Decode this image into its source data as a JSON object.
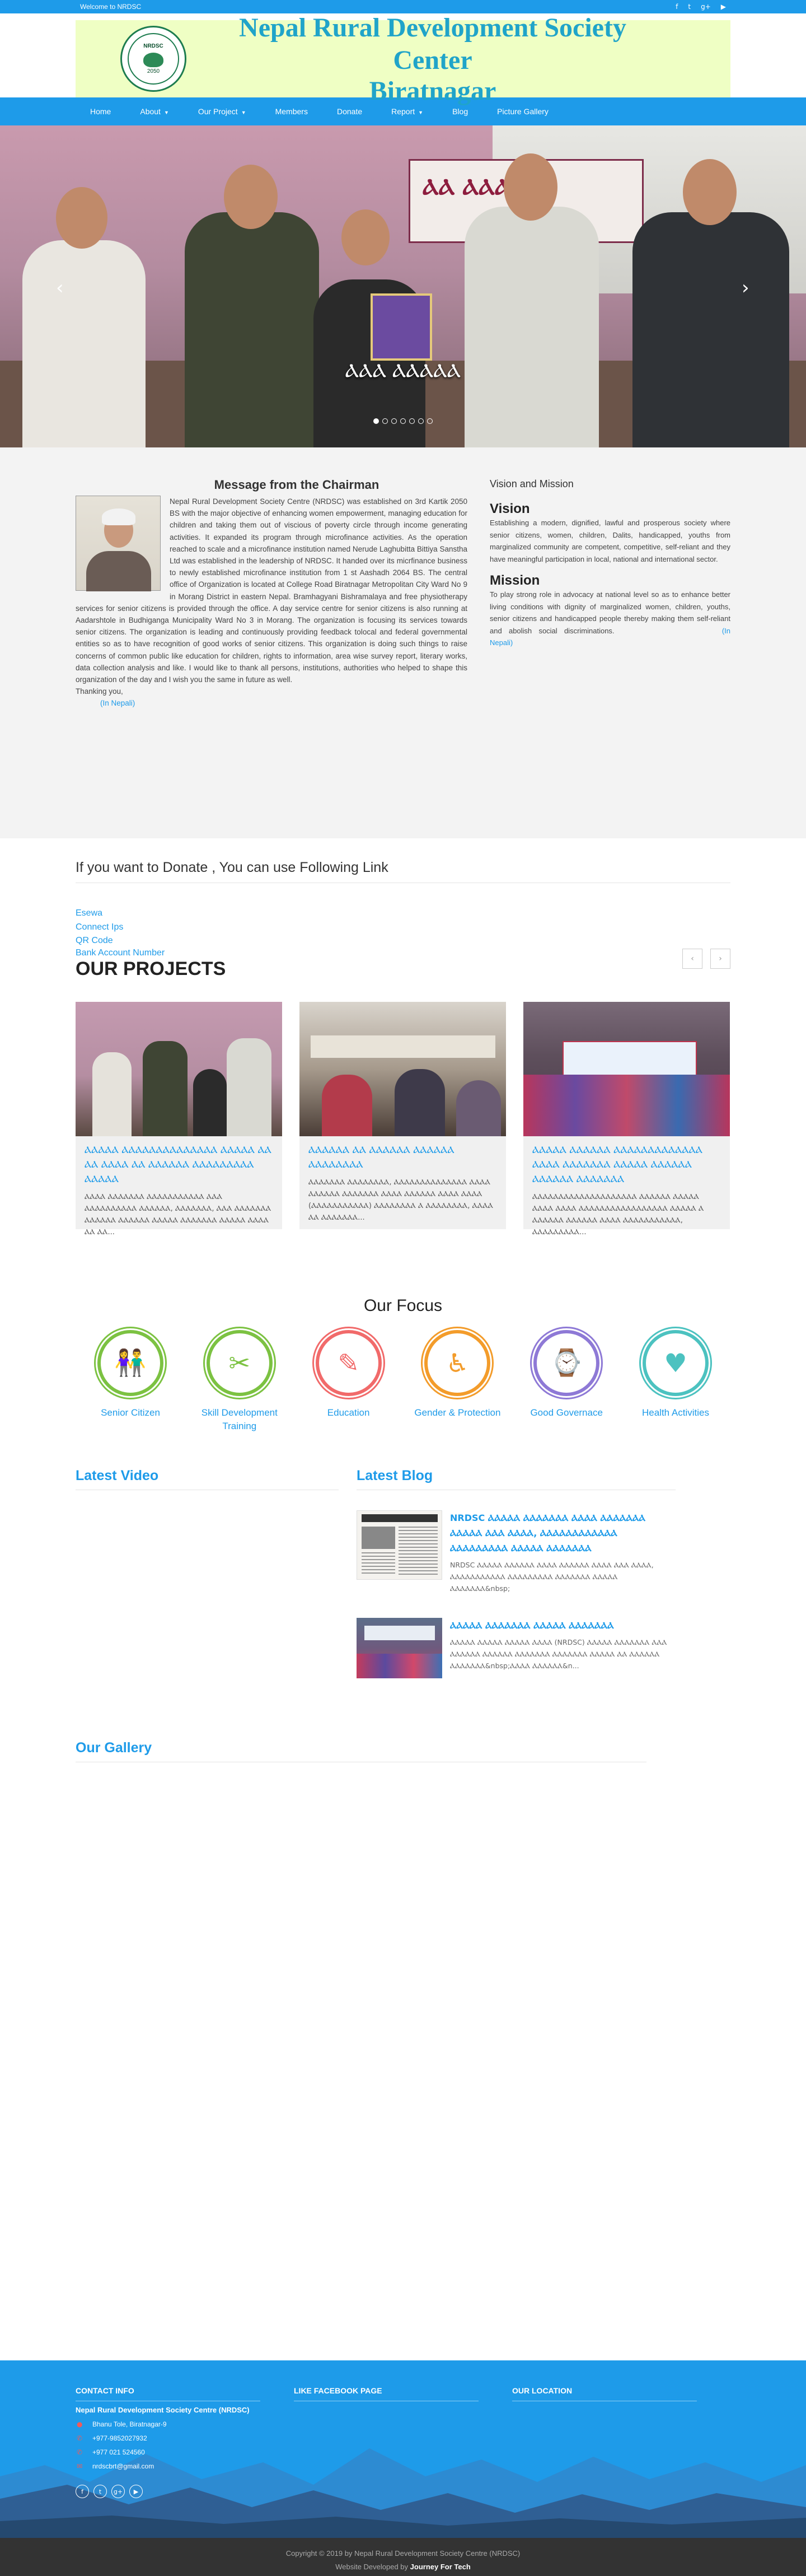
{
  "topbar": {
    "welcome": "Welcome to NRDSC",
    "social": [
      "f",
      "t",
      "g+",
      "▶"
    ]
  },
  "banner": {
    "line1": "Nepal Rural Development Society Center",
    "line2": "Biratnagar",
    "logo_text": "NRDSC",
    "logo_year": "2050"
  },
  "nav": [
    {
      "label": "Home",
      "caret": false
    },
    {
      "label": "About",
      "caret": true
    },
    {
      "label": "Our Project",
      "caret": true
    },
    {
      "label": "Members",
      "caret": false
    },
    {
      "label": "Donate",
      "caret": false
    },
    {
      "label": "Report",
      "caret": true
    },
    {
      "label": "Blog",
      "caret": false
    },
    {
      "label": "Picture Gallery",
      "caret": false
    }
  ],
  "slider": {
    "caption": "ⲀⲀⲀ ⲀⲀⲀⲀⲀ",
    "prev": "‹",
    "next": "›",
    "dots": 7,
    "active": 0,
    "banner_text": "ⲀⲀ ⲀⲀⲀⲀ"
  },
  "chairman": {
    "title": "Message from the Chairman",
    "body": "Nepal Rural Development Society Centre (NRDSC) was established on 3rd Kartik 2050 BS with the major objective of enhancing women empowerment, managing education for children and taking them out of viscious of poverty circle through income generating activities. It expanded its program through microfinance activities. As the operation reached to scale and a microfinance institution named Nerude Laghubitta Bittiya Sanstha Ltd was established in the leadership of NRDSC. It handed over its micrfinance business to newly established microfinance institution from 1 st Aashadh 2064 BS. The central office of Organization is located at College Road Biratnagar Metropolitan City Ward No 9 in Morang District in eastern Nepal. Bramhagyani Bishramalaya and free physiotherapy services for senior citizens is provided through the office. A day service centre for senior citizens is also running at Aadarshtole in Budhiganga Municipality Ward No 3 in Morang. The organization is focusing its services towards senior citizens. The organization is leading and continuously providing feedback tolocal and federal governmental entities so as to have recognition of good works of senior citizens. This organization is doing such things to raise concerns of common public like education for children, rights to information, area wise survey report, literary works, data collection analysis and like. I would like to thank all persons, institutions, authorities who helped to shape this organization of the day and I wish you the same in future as well.",
    "thanks": "Thanking you,",
    "nepali_link": "(In Nepali)"
  },
  "vision": {
    "heading": "Vision and Mission",
    "vision_title": "Vision",
    "vision_text": "Establishing a modern, dignified, lawful and prosperous society where senior citizens, women, children, Dalits, handicapped, youths from marginalized community are competent, competitive, self-reliant and they have meaningful participation in local, national and international sector.",
    "mission_title": "Mission",
    "mission_text": "To play strong role in advocacy at national level so as to enhance better living conditions with dignity of marginalized women, children, youths, senior citizens and handicapped people thereby making them self-reliant and abolish social discriminations.",
    "nepali_link": "(In Nepali)"
  },
  "donate": {
    "title": "If you want to Donate , You can use Following Link",
    "links": [
      "Esewa",
      "Connect Ips",
      "QR Code",
      "Bank Account Number"
    ]
  },
  "projects": {
    "title": "OUR PROJECTS",
    "prev": "‹",
    "next": "›",
    "items": [
      {
        "title": "ⲀⲀⲀⲀⲀ ⲀⲀⲀⲀⲀⲀⲀⲀⲀⲀⲀⲀⲀⲀ ⲀⲀⲀⲀⲀ ⲀⲀ ⲀⲀ ⲀⲀⲀⲀ ⲀⲀ ⲀⲀⲀⲀⲀⲀ ⲀⲀⲀⲀⲀⲀⲀⲀⲀ ⲀⲀⲀⲀⲀ",
        "desc": "ⲀⲀⲀⲀ ⲀⲀⲀⲀⲀⲀⲀ ⲀⲀⲀⲀⲀⲀⲀⲀⲀⲀⲀ ⲀⲀⲀ ⲀⲀⲀⲀⲀⲀⲀⲀⲀⲀ ⲀⲀⲀⲀⲀⲀ, ⲀⲀⲀⲀⲀⲀⲀ, ⲀⲀⲀ ⲀⲀⲀⲀⲀⲀⲀ ⲀⲀⲀⲀⲀⲀ ⲀⲀⲀⲀⲀⲀ ⲀⲀⲀⲀⲀ ⲀⲀⲀⲀⲀⲀⲀ ⲀⲀⲀⲀⲀ ⲀⲀⲀⲀ ⲀⲀ ⲀⲀ..."
      },
      {
        "title": "ⲀⲀⲀⲀⲀⲀ ⲀⲀ ⲀⲀⲀⲀⲀⲀ ⲀⲀⲀⲀⲀⲀ ⲀⲀⲀⲀⲀⲀⲀⲀ",
        "desc": "ⲀⲀⲀⲀⲀⲀⲀ ⲀⲀⲀⲀⲀⲀⲀⲀ, ⲀⲀⲀⲀⲀⲀⲀⲀⲀⲀⲀⲀⲀⲀ ⲀⲀⲀⲀ ⲀⲀⲀⲀⲀⲀ ⲀⲀⲀⲀⲀⲀⲀ ⲀⲀⲀⲀ ⲀⲀⲀⲀⲀⲀ ⲀⲀⲀⲀ ⲀⲀⲀⲀ (ⲀⲀⲀⲀⲀⲀⲀⲀⲀⲀⲀ) ⲀⲀⲀⲀⲀⲀⲀⲀ Ⲁ ⲀⲀⲀⲀⲀⲀⲀⲀ, ⲀⲀⲀⲀ ⲀⲀ ⲀⲀⲀⲀⲀⲀⲀ..."
      },
      {
        "title": "ⲀⲀⲀⲀⲀ ⲀⲀⲀⲀⲀⲀ ⲀⲀⲀⲀⲀⲀⲀⲀⲀⲀⲀⲀⲀ ⲀⲀⲀⲀ ⲀⲀⲀⲀⲀⲀⲀ ⲀⲀⲀⲀⲀ ⲀⲀⲀⲀⲀⲀ ⲀⲀⲀⲀⲀⲀ ⲀⲀⲀⲀⲀⲀⲀ",
        "desc": "ⲀⲀⲀⲀⲀⲀⲀⲀⲀⲀⲀⲀⲀⲀⲀⲀⲀⲀⲀⲀ ⲀⲀⲀⲀⲀⲀ ⲀⲀⲀⲀⲀ ⲀⲀⲀⲀ ⲀⲀⲀⲀ ⲀⲀⲀⲀⲀⲀⲀⲀⲀⲀⲀⲀⲀⲀⲀⲀⲀ ⲀⲀⲀⲀⲀ Ⲁ ⲀⲀⲀⲀⲀⲀ ⲀⲀⲀⲀⲀⲀ ⲀⲀⲀⲀ ⲀⲀⲀⲀⲀⲀⲀⲀⲀⲀⲀ, ⲀⲀⲀⲀⲀⲀⲀⲀⲀ..."
      }
    ]
  },
  "focus": {
    "title": "Our Focus",
    "items": [
      {
        "label": "Senior Citizen",
        "icon": "senior-citizen-icon",
        "color": "#7cc242"
      },
      {
        "label": "Skill Development Training",
        "icon": "tools-icon",
        "color": "#7cc242"
      },
      {
        "label": "Education",
        "icon": "education-icon",
        "color": "#f16a6a"
      },
      {
        "label": "Gender & Protection",
        "icon": "wheelchair-icon",
        "color": "#f39c2b"
      },
      {
        "label": "Good Governace",
        "icon": "governance-icon",
        "color": "#8e79d6"
      },
      {
        "label": "Health Activities",
        "icon": "health-icon",
        "color": "#4cc2c0"
      }
    ]
  },
  "latest": {
    "video_title": "Latest Video",
    "blog_title": "Latest Blog",
    "blogs": [
      {
        "title": "NRDSC ⲀⲀⲀⲀⲀ ⲀⲀⲀⲀⲀⲀⲀ ⲀⲀⲀⲀ ⲀⲀⲀⲀⲀⲀⲀ ⲀⲀⲀⲀⲀ ⲀⲀⲀ ⲀⲀⲀⲀ, ⲀⲀⲀⲀⲀⲀⲀⲀⲀⲀⲀⲀ ⲀⲀⲀⲀⲀⲀⲀⲀⲀ ⲀⲀⲀⲀⲀ ⲀⲀⲀⲀⲀⲀⲀ",
        "desc": "NRDSC ⲀⲀⲀⲀⲀ ⲀⲀⲀⲀⲀⲀ ⲀⲀⲀⲀ ⲀⲀⲀⲀⲀⲀ ⲀⲀⲀⲀ ⲀⲀⲀ ⲀⲀⲀⲀ, ⲀⲀⲀⲀⲀⲀⲀⲀⲀⲀⲀ ⲀⲀⲀⲀⲀⲀⲀⲀⲀ ⲀⲀⲀⲀⲀⲀⲀ ⲀⲀⲀⲀⲀ ⲀⲀⲀⲀⲀⲀⲀ&nbsp;"
      },
      {
        "title": "ⲀⲀⲀⲀⲀ ⲀⲀⲀⲀⲀⲀⲀ ⲀⲀⲀⲀⲀ ⲀⲀⲀⲀⲀⲀⲀ",
        "desc": "ⲀⲀⲀⲀⲀ ⲀⲀⲀⲀⲀ ⲀⲀⲀⲀⲀ ⲀⲀⲀⲀ (NRDSC) ⲀⲀⲀⲀⲀ ⲀⲀⲀⲀⲀⲀⲀ ⲀⲀⲀ ⲀⲀⲀⲀⲀⲀ ⲀⲀⲀⲀⲀⲀ ⲀⲀⲀⲀⲀⲀⲀ ⲀⲀⲀⲀⲀⲀⲀ ⲀⲀⲀⲀⲀ ⲀⲀ ⲀⲀⲀⲀⲀⲀ ⲀⲀⲀⲀⲀⲀⲀ&nbsp;ⲀⲀⲀⲀ ⲀⲀⲀⲀⲀⲀ&n..."
      }
    ]
  },
  "gallery": {
    "title": "Our Gallery"
  },
  "footer": {
    "contact_title": "CONTACT INFO",
    "facebook_title": "LIKE FACEBOOK PAGE",
    "location_title": "OUR LOCATION",
    "org": "Nepal Rural Development Society Centre (NRDSC)",
    "lines": [
      {
        "icon": "map-pin-icon",
        "glyph": "●",
        "text": "Bhanu Tole, Biratnagar-9"
      },
      {
        "icon": "phone-icon",
        "glyph": "✆",
        "text": "+977-9852027932"
      },
      {
        "icon": "phone-icon",
        "glyph": "✆",
        "text": "+977 021 524560"
      },
      {
        "icon": "mail-icon",
        "glyph": "✉",
        "text": "nrdscbrt@gmail.com"
      }
    ],
    "social": [
      "f",
      "t",
      "g+",
      "▶"
    ],
    "copyright": "Copyright © 2019 by Nepal Rural Development Society Centre (NRDSC)",
    "dev_prefix": "Website Developed by",
    "dev_name": "Journey For Tech"
  }
}
